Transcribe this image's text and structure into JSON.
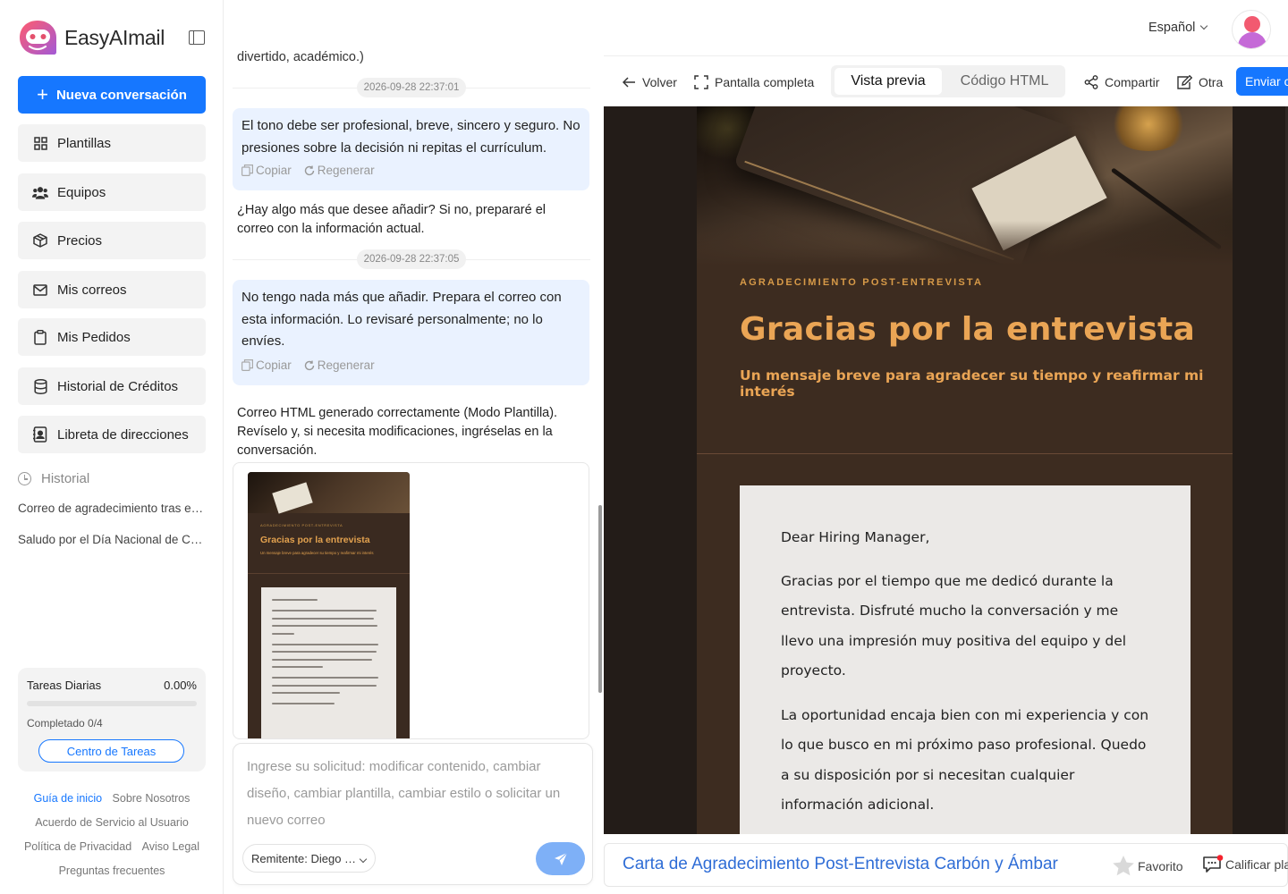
{
  "brand": {
    "name": "EasyAImail"
  },
  "sidebar": {
    "new_conversation": "Nueva conversación",
    "items": [
      {
        "label": "Plantillas",
        "icon": "grid-icon"
      },
      {
        "label": "Equipos",
        "icon": "users-icon"
      },
      {
        "label": "Precios",
        "icon": "box-icon"
      },
      {
        "label": "Mis correos",
        "icon": "mail-icon"
      },
      {
        "label": "Mis Pedidos",
        "icon": "clipboard-icon"
      },
      {
        "label": "Historial de Créditos",
        "icon": "database-icon"
      },
      {
        "label": "Libreta de direcciones",
        "icon": "contact-book-icon"
      }
    ],
    "history_title": "Historial",
    "history": [
      "Correo de agradecimiento tras entrevista",
      "Saludo por el Día Nacional de Chile"
    ],
    "tasks": {
      "title": "Tareas Diarias",
      "percent": "0.00%",
      "progress": 0,
      "completed": "Completado 0/4",
      "button": "Centro de Tareas"
    },
    "footer": {
      "guide": "Guía de inicio",
      "about": "Sobre Nosotros",
      "terms": "Acuerdo de Servicio al Usuario",
      "privacy": "Política de Privacidad",
      "legal": "Aviso Legal",
      "faq": "Preguntas frecuentes"
    }
  },
  "chat": {
    "partial_text": "divertido, académico.)",
    "ts1": "2026-09-28 22:37:01",
    "user_msg1": "El tono debe ser profesional, breve, sincero y seguro. No presiones sobre la decisión ni repitas el currículum.",
    "copy": "Copiar",
    "regenerate": "Regenerar",
    "ai_msg1": "¿Hay algo más que desee añadir? Si no, prepararé el correo con la información actual.",
    "ts2": "2026-09-28 22:37:05",
    "user_msg2": "No tengo nada más que añadir. Prepara el correo con esta información. Lo revisaré personalmente; no lo envíes.",
    "ai_msg2": "Correo HTML generado correctamente (Modo Plantilla). Revíselo y, si necesita modificaciones, ingréselas en la conversación.",
    "thumb": {
      "kicker": "AGRADECIMIENTO POST-ENTREVISTA",
      "title": "Gracias por la entrevista",
      "subtitle": "Un mensaje breve para agradecer su tiempo y reafirmar mi interés"
    },
    "composer_placeholder": "Ingrese su solicitud: modificar contenido, cambiar diseño, cambiar plantilla, cambiar estilo o solicitar un nuevo correo",
    "sender": "Remitente: Diego …"
  },
  "topbar": {
    "language": "Español"
  },
  "toolbar": {
    "back": "Volver",
    "fullscreen": "Pantalla completa",
    "preview": "Vista previa",
    "html_code": "Código HTML",
    "share": "Compartir",
    "other": "Otra",
    "send": "Enviar c"
  },
  "email": {
    "kicker": "AGRADECIMIENTO POST-ENTREVISTA",
    "title": "Gracias por la entrevista",
    "subtitle": "Un mensaje breve para agradecer su tiempo y reafirmar mi interés",
    "greeting": "Dear Hiring Manager,",
    "p1": "Gracias por el tiempo que me dedicó durante la entrevista. Disfruté mucho la conversación y me llevo una impresión muy positiva del equipo y del proyecto.",
    "p2": "La oportunidad encaja bien con mi experiencia y con lo que busco en mi próximo paso profesional. Quedo a su disposición por si necesitan cualquier información adicional."
  },
  "bottom": {
    "template_name": "Carta de Agradecimiento Post-Entrevista Carbón y Ámbar",
    "favorite": "Favorito",
    "rate": "Calificar pla"
  },
  "colors": {
    "primary": "#1677ff",
    "email_bg": "#3d2c20",
    "amber": "#eaa555",
    "user_bubble": "#eaf2ff"
  }
}
